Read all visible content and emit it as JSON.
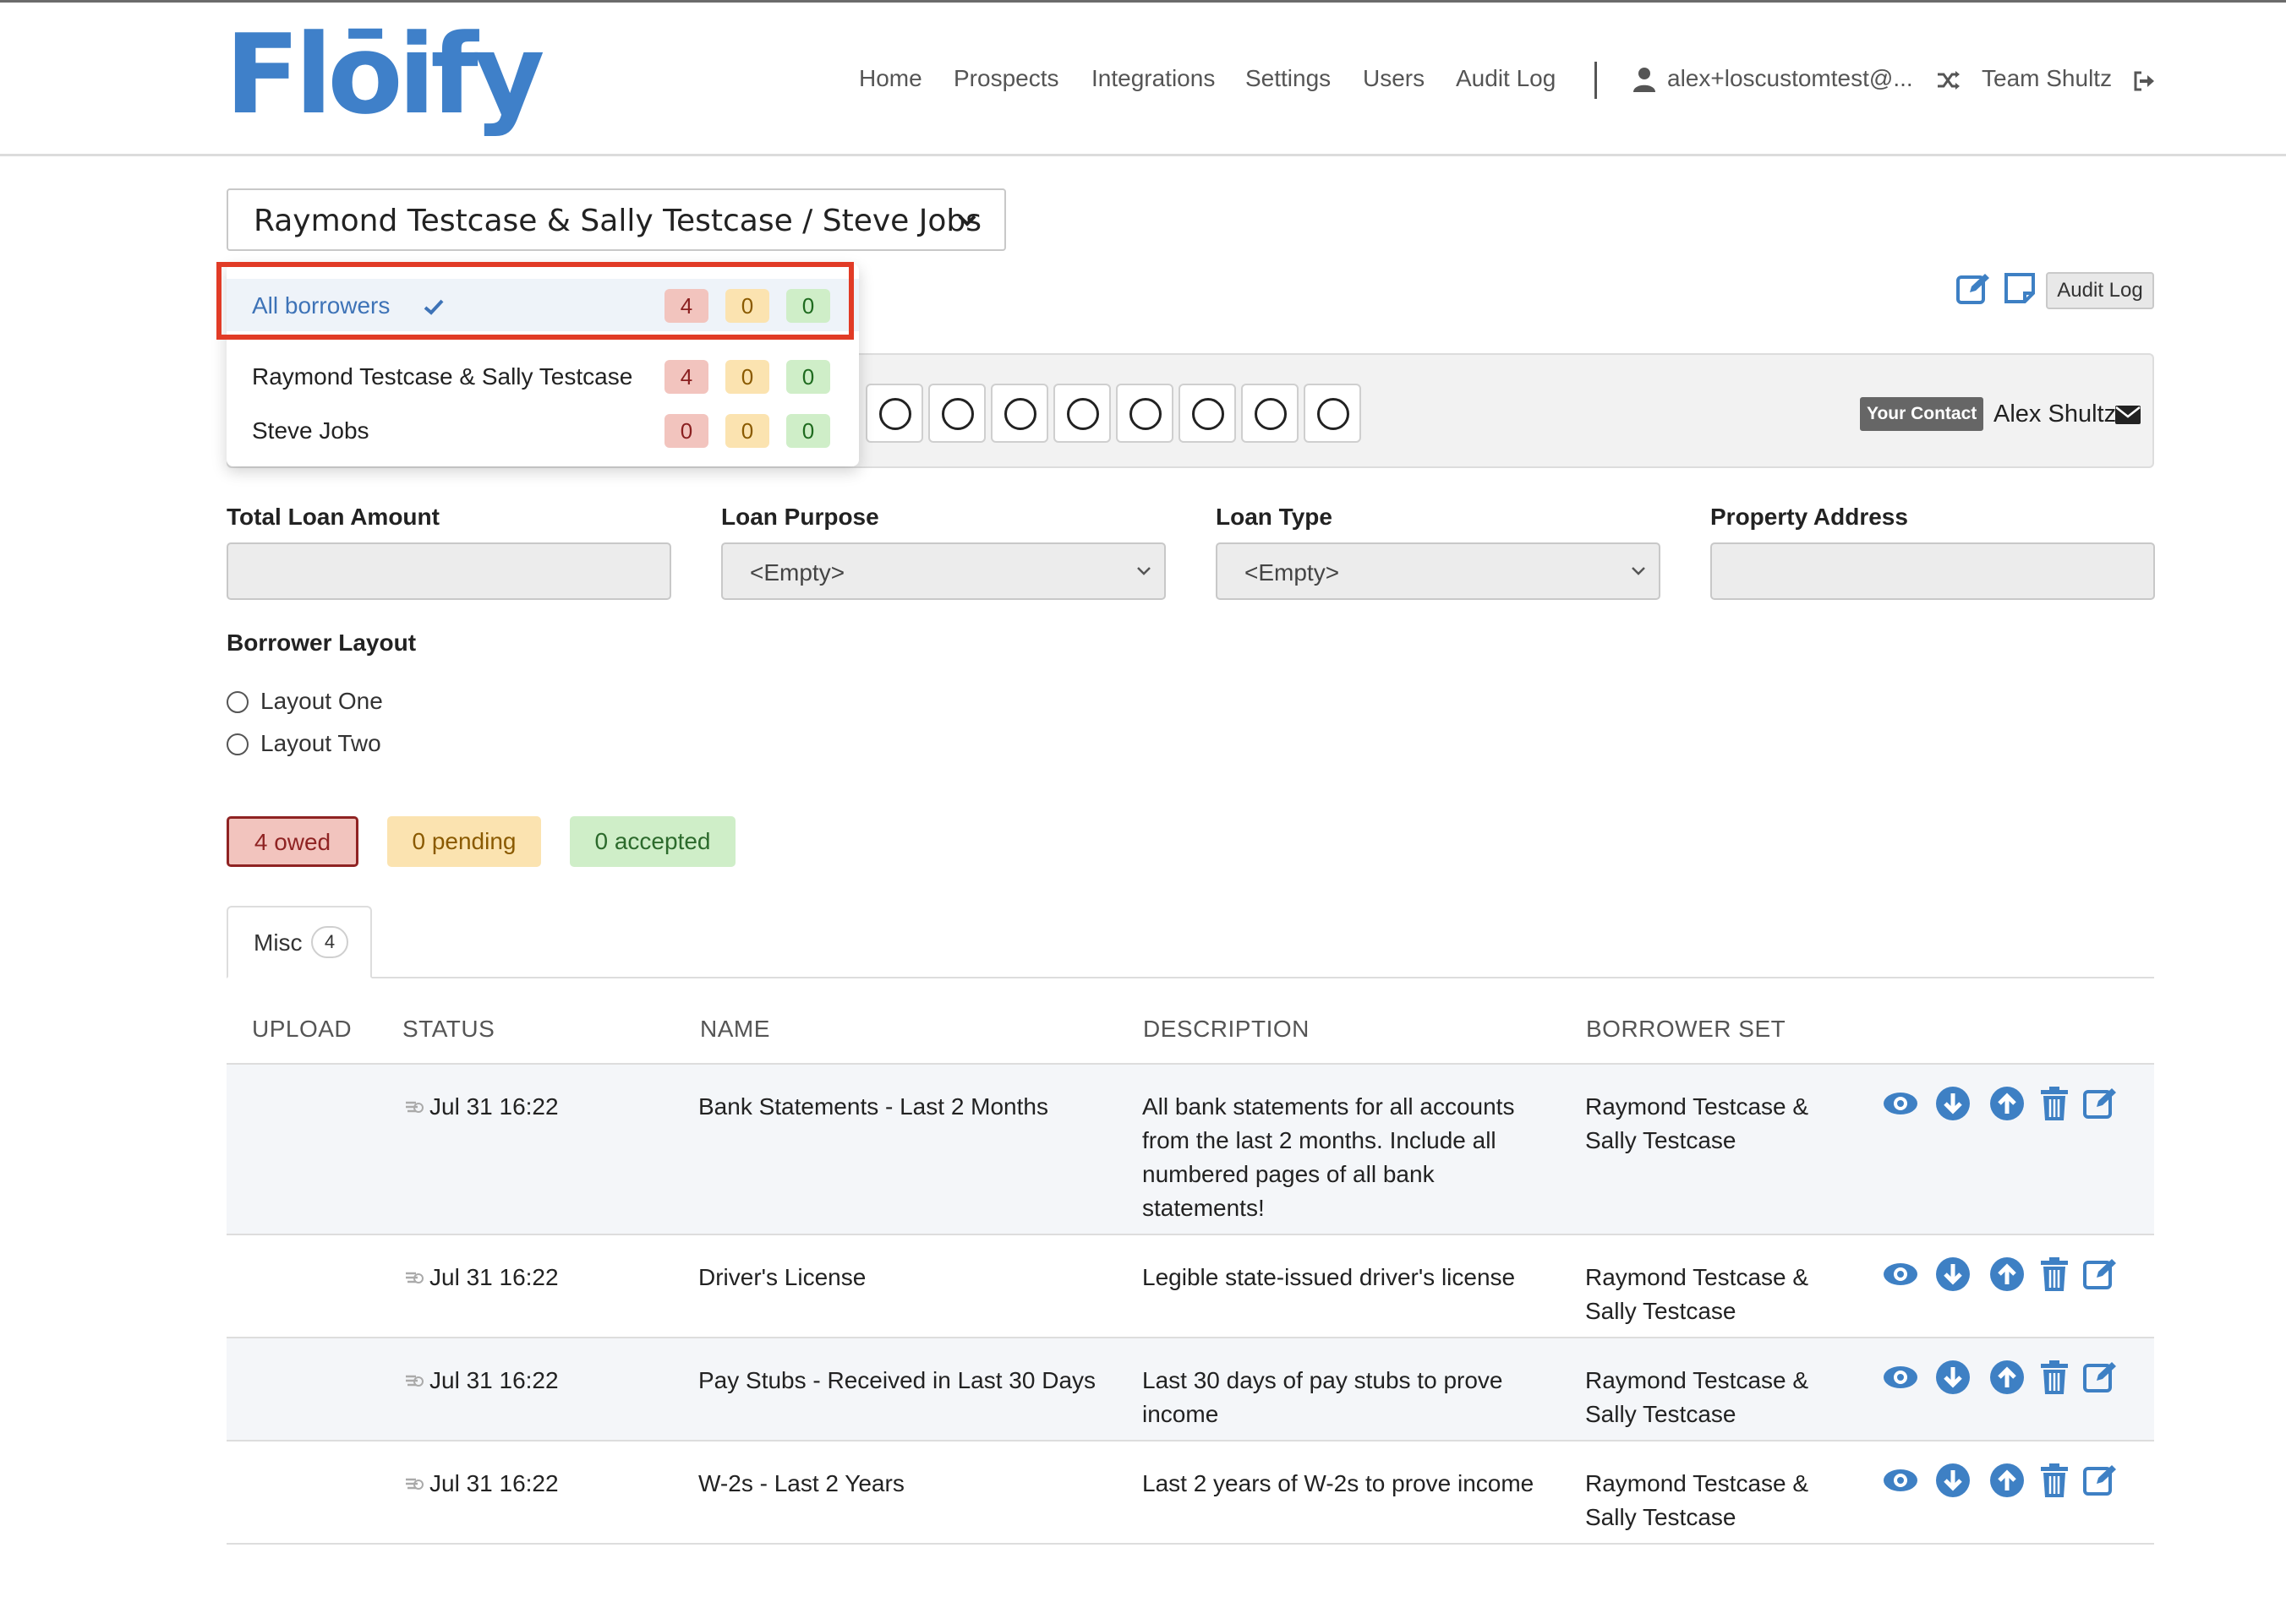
{
  "brand": {
    "logo_text": "Flōify",
    "accent": "#3f80c9"
  },
  "nav": {
    "items": [
      "Home",
      "Prospects",
      "Integrations",
      "Settings",
      "Users",
      "Audit Log"
    ],
    "user": "alex+loscustomtest@...",
    "team": "Team Shultz",
    "icons": [
      "user-icon",
      "shuffle-icon",
      "sign-out-icon"
    ]
  },
  "selector": {
    "value": "Raymond Testcase & Sally Testcase / Steve Jobs"
  },
  "dropdown": {
    "items": [
      {
        "label": "All borrowers",
        "owed": "4",
        "pending": "0",
        "accepted": "0",
        "selected": true
      },
      {
        "label": "Raymond Testcase & Sally Testcase",
        "owed": "4",
        "pending": "0",
        "accepted": "0",
        "selected": false
      },
      {
        "label": "Steve Jobs",
        "owed": "0",
        "pending": "0",
        "accepted": "0",
        "selected": false
      }
    ]
  },
  "toolbar": {
    "audit_log": "Audit Log"
  },
  "contact": {
    "badge": "Your Contact",
    "name": "Alex Shultz"
  },
  "fields": {
    "total_loan_amount": {
      "label": "Total Loan Amount",
      "value": ""
    },
    "loan_purpose": {
      "label": "Loan Purpose",
      "value": "<Empty>"
    },
    "loan_type": {
      "label": "Loan Type",
      "value": "<Empty>"
    },
    "property_address": {
      "label": "Property Address",
      "value": ""
    }
  },
  "borrower_layout": {
    "label": "Borrower Layout",
    "options": [
      "Layout One",
      "Layout Two"
    ]
  },
  "status_chips": {
    "owed": "4 owed",
    "pending": "0 pending",
    "accepted": "0 accepted"
  },
  "tabs": [
    {
      "label": "Misc",
      "count": "4"
    }
  ],
  "table": {
    "headers": [
      "UPLOAD",
      "STATUS",
      "NAME",
      "DESCRIPTION",
      "BORROWER SET"
    ],
    "rows": [
      {
        "status": "Jul 31 16:22",
        "name": "Bank Statements - Last 2 Months",
        "description": "All bank statements for all accounts from the last 2 months. Include all numbered pages of all bank statements!",
        "borrower_set": "Raymond Testcase & Sally Testcase"
      },
      {
        "status": "Jul 31 16:22",
        "name": "Driver's License",
        "description": "Legible state-issued driver's license",
        "borrower_set": "Raymond Testcase & Sally Testcase"
      },
      {
        "status": "Jul 31 16:22",
        "name": "Pay Stubs - Received in Last 30 Days",
        "description": "Last 30 days of pay stubs to prove income",
        "borrower_set": "Raymond Testcase & Sally Testcase"
      },
      {
        "status": "Jul 31 16:22",
        "name": "W-2s - Last 2 Years",
        "description": "Last 2 years of W-2s to prove income",
        "borrower_set": "Raymond Testcase & Sally Testcase"
      }
    ],
    "row_actions": [
      "eye-icon",
      "download-icon",
      "upload-icon",
      "trash-icon",
      "edit-icon"
    ]
  }
}
